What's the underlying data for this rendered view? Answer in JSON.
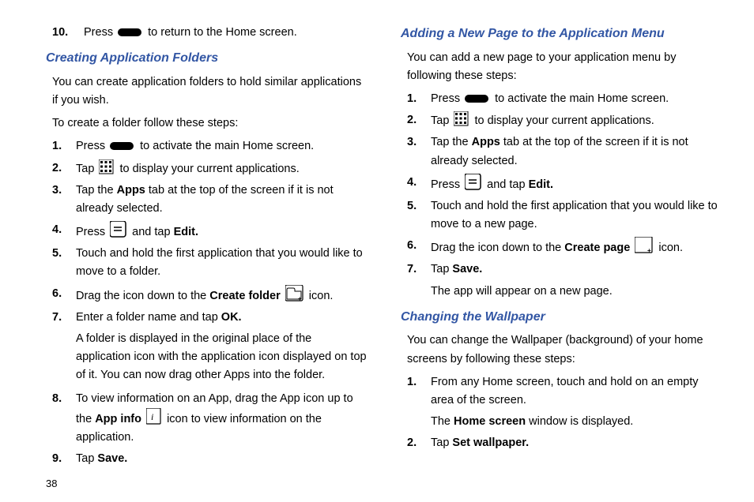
{
  "col1": {
    "step10_a": "Press",
    "step10_b": "to return to the Home screen.",
    "heading1": "Creating Application Folders",
    "intro1": "You can create application folders to hold similar applications if you wish.",
    "intro2": "To create a folder follow these steps:",
    "s1_a": "Press",
    "s1_b": "to activate the main Home screen.",
    "s2_a": "Tap",
    "s2_b": "to display your current applications.",
    "s3_a": "Tap the",
    "s3_bold": "Apps",
    "s3_b": "tab at the top of the screen if it is not already selected.",
    "s4_a": "Press",
    "s4_b": "and tap",
    "s4_bold": "Edit",
    "s5": "Touch and hold the first application that you would like to move to a folder.",
    "s6_a": "Drag the icon down to the",
    "s6_bold": "Create folder",
    "s6_b": "icon.",
    "s7_a": "Enter a folder name and tap",
    "s7_bold": "OK",
    "s7_follow": "A folder is displayed in the original place of the application icon with the application icon displayed on top of it. You can now drag other Apps into the folder.",
    "s8_a": "To view information on an App, drag the App icon up to the",
    "s8_bold": "App info",
    "s8_b": "icon to view information on the application.",
    "s9_a": "Tap",
    "s9_bold": "Save"
  },
  "col2": {
    "heading2": "Adding a New Page to the Application Menu",
    "intro3": "You can add a new page to your application menu by following these steps:",
    "p1_a": "Press",
    "p1_b": "to activate the main Home screen.",
    "p2_a": "Tap",
    "p2_b": "to display your current applications.",
    "p3_a": "Tap the",
    "p3_bold": "Apps",
    "p3_b": "tab at the top of the screen if it is not already selected.",
    "p4_a": "Press",
    "p4_b": "and tap",
    "p4_bold": "Edit",
    "p5": "Touch and hold the first application that you would like to move to a new page.",
    "p6_a": "Drag the icon down to the",
    "p6_bold": "Create page",
    "p6_b": "icon.",
    "p7_a": "Tap",
    "p7_bold": "Save",
    "p7_follow": "The app will appear on a new page.",
    "heading3": "Changing the Wallpaper",
    "intro4": "You can change the Wallpaper (background) of your home screens by following these steps:",
    "w1": "From any Home screen, touch and hold on an empty area of the screen.",
    "w1_follow_a": "The",
    "w1_follow_bold": "Home screen",
    "w1_follow_b": "window is displayed.",
    "w2_a": "Tap",
    "w2_bold": "Set wallpaper"
  },
  "page_number": "38"
}
